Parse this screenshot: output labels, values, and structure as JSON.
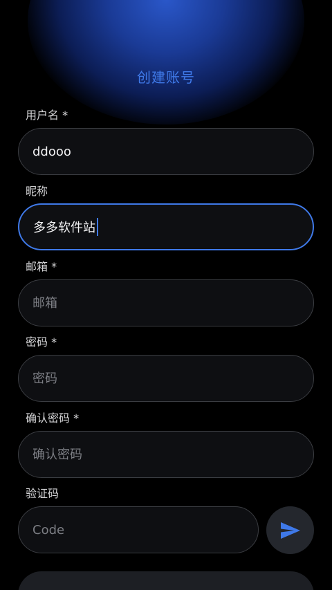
{
  "page": {
    "title": "创建账号"
  },
  "form": {
    "username": {
      "label": "用户名 *",
      "value": "ddooo"
    },
    "nickname": {
      "label": "昵称",
      "value": "多多软件站"
    },
    "email": {
      "label": "邮箱 *",
      "placeholder": "邮箱"
    },
    "password": {
      "label": "密码 *",
      "placeholder": "密码"
    },
    "confirm_password": {
      "label": "确认密码 *",
      "placeholder": "确认密码"
    },
    "verification": {
      "label": "验证码",
      "placeholder": "Code",
      "send_icon": "send-icon"
    }
  },
  "colors": {
    "accent": "#3f79e8",
    "background": "#000000",
    "field_bg": "#0e0f12",
    "field_border": "#3b3d42"
  }
}
